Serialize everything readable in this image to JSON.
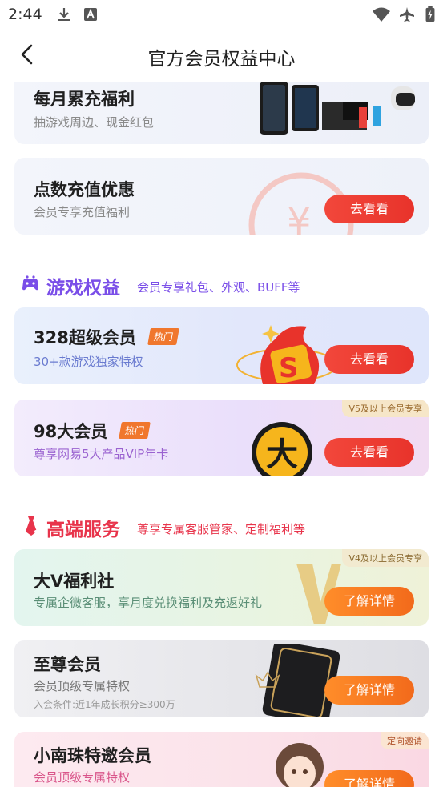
{
  "status_bar": {
    "time": "2:44"
  },
  "header": {
    "title": "官方会员权益中心"
  },
  "cards": {
    "monthly": {
      "title": "每月累充福利",
      "subtitle": "抽游戏周边、现金红包"
    },
    "points": {
      "title": "点数充值优惠",
      "subtitle": "会员专享充值福利",
      "button": "去看看"
    },
    "super328": {
      "title": "328超级会员",
      "tag": "热门",
      "subtitle": "30+款游戏独家特权",
      "button": "去看看"
    },
    "big98": {
      "title": "98大会员",
      "tag": "热门",
      "subtitle": "尊享网易5大产品VIP年卡",
      "corner": "V5及以上会员专享",
      "button": "去看看"
    },
    "bigv": {
      "title": "大V福利社",
      "subtitle": "专属企微客服，享月度兑换福利及充返好礼",
      "corner": "V4及以上会员专享",
      "button": "了解详情"
    },
    "supreme": {
      "title": "至尊会员",
      "subtitle": "会员顶级专属特权",
      "note": "入会条件:近1年成长积分≥300万",
      "button": "了解详情"
    },
    "xiaonanzhu": {
      "title": "小南珠特邀会员",
      "subtitle": "会员顶级专属特权",
      "corner": "定向邀请",
      "button": "了解详情"
    }
  },
  "sections": {
    "game": {
      "title": "游戏权益",
      "subtitle": "会员专享礼包、外观、BUFF等"
    },
    "premium": {
      "title": "高端服务",
      "subtitle": "尊享专属客服管家、定制福利等"
    }
  },
  "colors": {
    "primary_red": "#e8332b",
    "purple": "#7a4ee8",
    "pink": "#e8344b",
    "orange": "#f26a1b"
  }
}
